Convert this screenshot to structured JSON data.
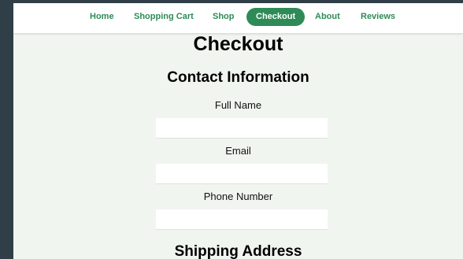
{
  "nav": {
    "items": [
      {
        "label": "Home",
        "active": false
      },
      {
        "label": "Shopping Cart",
        "active": false
      },
      {
        "label": "Shop",
        "active": false
      },
      {
        "label": "Checkout",
        "active": true
      },
      {
        "label": "About",
        "active": false
      },
      {
        "label": "Reviews",
        "active": false
      }
    ]
  },
  "page": {
    "title": "Checkout"
  },
  "contact": {
    "heading": "Contact Information",
    "full_name_label": "Full Name",
    "full_name_value": "",
    "email_label": "Email",
    "email_value": "",
    "phone_label": "Phone Number",
    "phone_value": ""
  },
  "shipping": {
    "heading": "Shipping Address"
  },
  "colors": {
    "accent": "#2e8b57",
    "page_background": "#f1f5ef",
    "outer_background": "#2f3e47"
  }
}
